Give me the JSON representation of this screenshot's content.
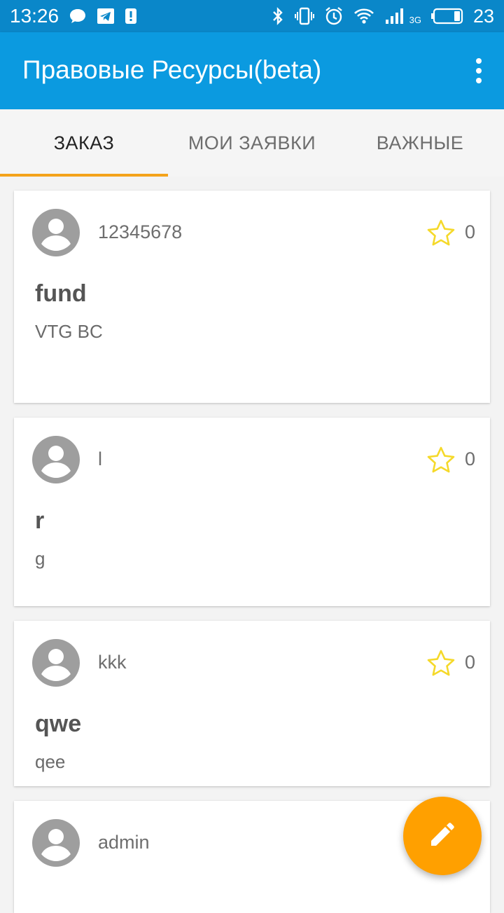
{
  "status_bar": {
    "time": "13:26",
    "network_type": "3G",
    "battery_level": "23",
    "icons": [
      "chat-icon",
      "telegram-icon",
      "alert-icon",
      "bluetooth-icon",
      "vibrate-icon",
      "alarm-icon",
      "wifi-icon",
      "signal-icon",
      "battery-icon"
    ]
  },
  "app_bar": {
    "title": "Правовые Ресурсы(beta)",
    "menu_icon": "more-vert-icon",
    "color": "#0b9ae0"
  },
  "tabs": [
    {
      "label": "ЗАКАЗ",
      "active": true
    },
    {
      "label": "МОИ ЗАЯВКИ",
      "active": false
    },
    {
      "label": "ВАЖНЫЕ",
      "active": false
    }
  ],
  "accent_color": "#f4a31b",
  "cards": [
    {
      "author": "12345678",
      "rating": "0",
      "title": "fund",
      "body": "VTG BC"
    },
    {
      "author": "l",
      "rating": "0",
      "title": "r",
      "body": "g"
    },
    {
      "author": "kkk",
      "rating": "0",
      "title": "qwe",
      "body": "qee"
    },
    {
      "author": "admin",
      "rating": "",
      "title": "",
      "body": ""
    }
  ],
  "fab": {
    "icon": "edit-pencil-icon",
    "color": "#ffa000"
  }
}
